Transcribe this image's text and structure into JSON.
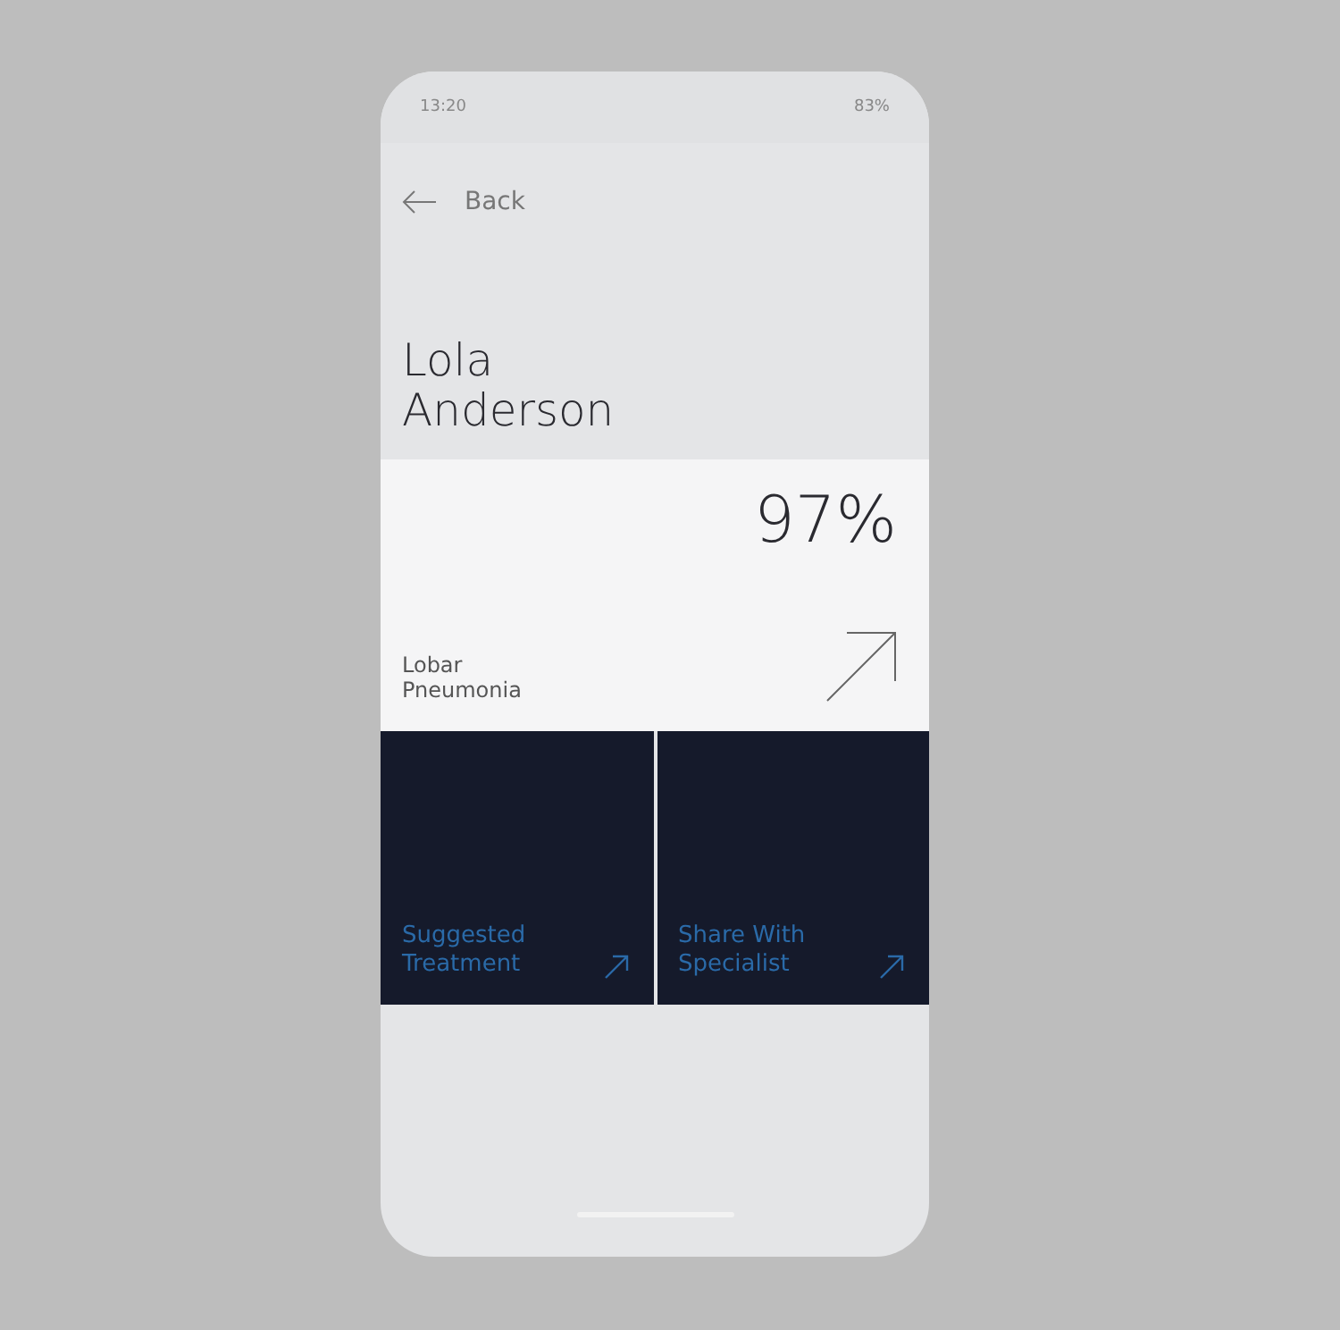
{
  "status_bar": {
    "time": "13:20",
    "battery": "83%"
  },
  "back": {
    "label": "Back"
  },
  "patient": {
    "name": "Lola\nAnderson"
  },
  "diagnosis": {
    "confidence": "97%",
    "name": "Lobar\nPneumonia"
  },
  "actions": [
    {
      "label": "Suggested\nTreatment"
    },
    {
      "label": "Share With\nSpecialist"
    }
  ]
}
